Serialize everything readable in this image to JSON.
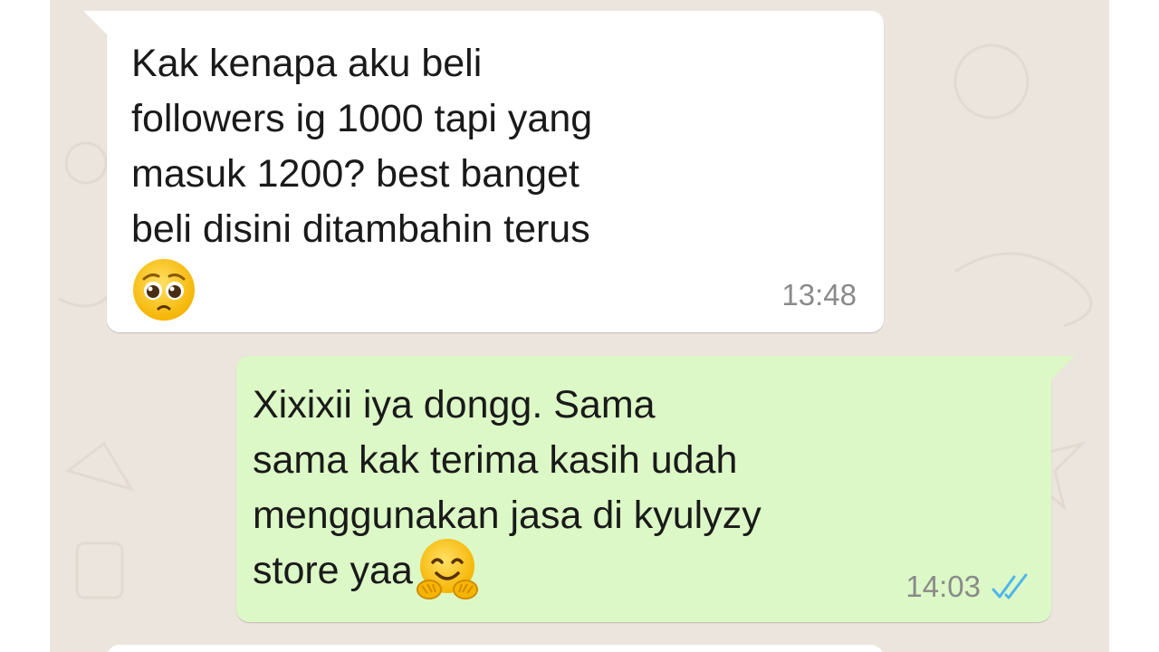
{
  "messages": [
    {
      "direction": "incoming",
      "lines": [
        "Kak kenapa aku beli",
        "followers ig 1000 tapi yang",
        "masuk 1200? best banget",
        "beli disini ditambahin terus"
      ],
      "emoji": "pleading-face",
      "time": "13:48"
    },
    {
      "direction": "outgoing",
      "lines": [
        "Xixixii iya dongg. Sama",
        "sama kak terima kasih udah",
        "menggunakan jasa di kyulyzy",
        "store yaa"
      ],
      "emoji": "hugging-face",
      "time": "14:03",
      "status": "read"
    }
  ],
  "colors": {
    "chat_background": "#ece5dd",
    "incoming_bubble": "#ffffff",
    "outgoing_bubble": "#dcf8c6",
    "read_ticks": "#4fb6ec",
    "timestamp": "#8a8a8a"
  },
  "icons": {
    "read_status": "double-check-icon"
  }
}
